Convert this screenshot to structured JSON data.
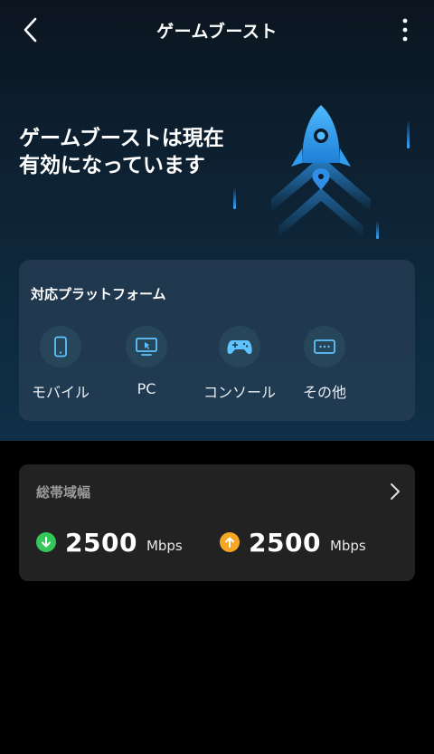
{
  "header": {
    "title": "ゲームブースト",
    "back_icon": "chevron-left-icon",
    "more_icon": "more-vertical-icon"
  },
  "hero": {
    "headline": "ゲームブーストは現在有効になっています",
    "illustration": "rocket-icon"
  },
  "platforms": {
    "title": "対応プラットフォーム",
    "items": [
      {
        "label": "モバイル",
        "icon": "smartphone-icon"
      },
      {
        "label": "PC",
        "icon": "monitor-icon"
      },
      {
        "label": "コンソール",
        "icon": "gamepad-icon"
      },
      {
        "label": "その他",
        "icon": "more-device-icon"
      }
    ]
  },
  "bandwidth": {
    "title": "総帯域幅",
    "download": {
      "value": "2500",
      "unit": "Mbps",
      "icon": "download-arrow-icon",
      "color": "#34c759"
    },
    "upload": {
      "value": "2500",
      "unit": "Mbps",
      "icon": "upload-arrow-icon",
      "color": "#f5a623"
    }
  },
  "colors": {
    "accent": "#3aa8ff",
    "icon_circle": "#27465a"
  }
}
